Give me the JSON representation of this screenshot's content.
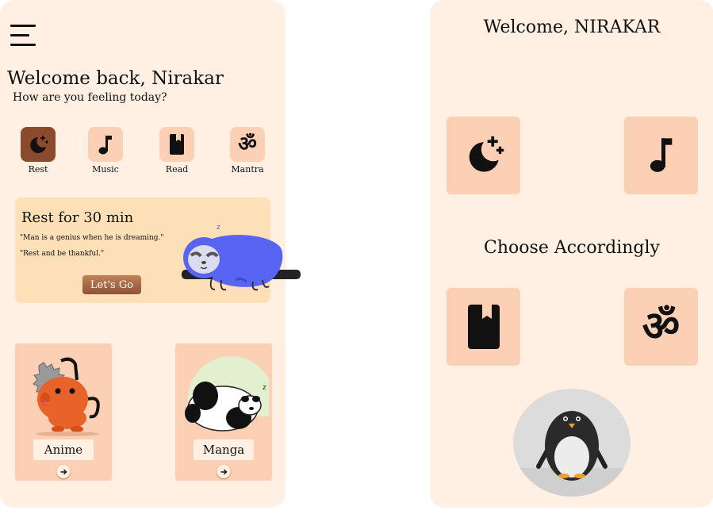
{
  "left": {
    "welcome_title": "Welcome back, Nirakar",
    "welcome_sub": "How are you feeling today?",
    "categories": [
      {
        "label": "Rest",
        "icon": "moon-stars-icon"
      },
      {
        "label": "Music",
        "icon": "music-note-icon"
      },
      {
        "label": "Read",
        "icon": "book-icon"
      },
      {
        "label": "Mantra",
        "icon": "om-icon"
      }
    ],
    "rest_card": {
      "title": "Rest for 30 min",
      "quote1": "\"Man is a genius when he is dreaming.\"",
      "quote2": "\"Rest and be thankful.\"",
      "button": "Let's Go",
      "sleep_mark": "z"
    },
    "media": [
      {
        "label": "Anime",
        "icon": "chainsaw-dog-illustration"
      },
      {
        "label": "Manga",
        "icon": "sleeping-panda-illustration"
      }
    ],
    "panda_sleep_mark": "z"
  },
  "right": {
    "title": "Welcome, NIRAKAR",
    "choose": "Choose Accordingly",
    "om_glyph": "ॐ"
  },
  "colors": {
    "panel_bg": "#fff0e3",
    "tile_bg": "#fbd0b5",
    "active_tile": "#8b4a2b",
    "card_bg": "#fde0b8",
    "sloth": "#5865f2"
  }
}
